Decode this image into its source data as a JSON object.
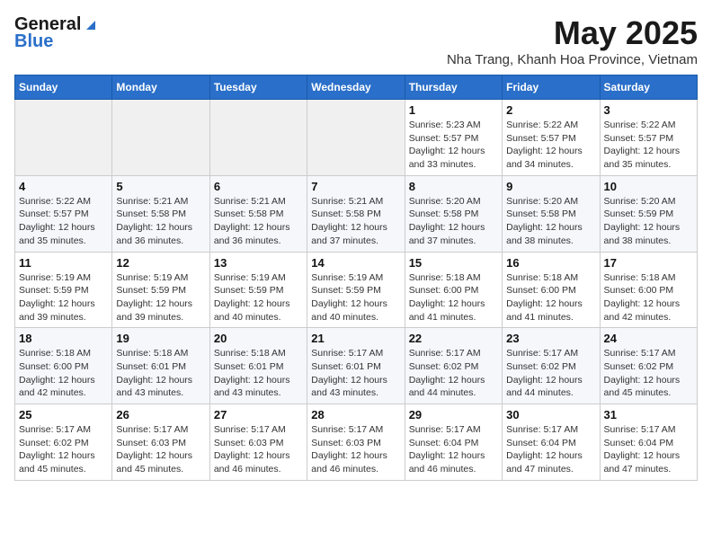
{
  "header": {
    "logo_line1": "General",
    "logo_line2": "Blue",
    "title": "May 2025",
    "subtitle": "Nha Trang, Khanh Hoa Province, Vietnam"
  },
  "calendar": {
    "days": [
      "Sunday",
      "Monday",
      "Tuesday",
      "Wednesday",
      "Thursday",
      "Friday",
      "Saturday"
    ],
    "weeks": [
      [
        {
          "date": "",
          "info": ""
        },
        {
          "date": "",
          "info": ""
        },
        {
          "date": "",
          "info": ""
        },
        {
          "date": "",
          "info": ""
        },
        {
          "date": "1",
          "info": "Sunrise: 5:23 AM\nSunset: 5:57 PM\nDaylight: 12 hours\nand 33 minutes."
        },
        {
          "date": "2",
          "info": "Sunrise: 5:22 AM\nSunset: 5:57 PM\nDaylight: 12 hours\nand 34 minutes."
        },
        {
          "date": "3",
          "info": "Sunrise: 5:22 AM\nSunset: 5:57 PM\nDaylight: 12 hours\nand 35 minutes."
        }
      ],
      [
        {
          "date": "4",
          "info": "Sunrise: 5:22 AM\nSunset: 5:57 PM\nDaylight: 12 hours\nand 35 minutes."
        },
        {
          "date": "5",
          "info": "Sunrise: 5:21 AM\nSunset: 5:58 PM\nDaylight: 12 hours\nand 36 minutes."
        },
        {
          "date": "6",
          "info": "Sunrise: 5:21 AM\nSunset: 5:58 PM\nDaylight: 12 hours\nand 36 minutes."
        },
        {
          "date": "7",
          "info": "Sunrise: 5:21 AM\nSunset: 5:58 PM\nDaylight: 12 hours\nand 37 minutes."
        },
        {
          "date": "8",
          "info": "Sunrise: 5:20 AM\nSunset: 5:58 PM\nDaylight: 12 hours\nand 37 minutes."
        },
        {
          "date": "9",
          "info": "Sunrise: 5:20 AM\nSunset: 5:58 PM\nDaylight: 12 hours\nand 38 minutes."
        },
        {
          "date": "10",
          "info": "Sunrise: 5:20 AM\nSunset: 5:59 PM\nDaylight: 12 hours\nand 38 minutes."
        }
      ],
      [
        {
          "date": "11",
          "info": "Sunrise: 5:19 AM\nSunset: 5:59 PM\nDaylight: 12 hours\nand 39 minutes."
        },
        {
          "date": "12",
          "info": "Sunrise: 5:19 AM\nSunset: 5:59 PM\nDaylight: 12 hours\nand 39 minutes."
        },
        {
          "date": "13",
          "info": "Sunrise: 5:19 AM\nSunset: 5:59 PM\nDaylight: 12 hours\nand 40 minutes."
        },
        {
          "date": "14",
          "info": "Sunrise: 5:19 AM\nSunset: 5:59 PM\nDaylight: 12 hours\nand 40 minutes."
        },
        {
          "date": "15",
          "info": "Sunrise: 5:18 AM\nSunset: 6:00 PM\nDaylight: 12 hours\nand 41 minutes."
        },
        {
          "date": "16",
          "info": "Sunrise: 5:18 AM\nSunset: 6:00 PM\nDaylight: 12 hours\nand 41 minutes."
        },
        {
          "date": "17",
          "info": "Sunrise: 5:18 AM\nSunset: 6:00 PM\nDaylight: 12 hours\nand 42 minutes."
        }
      ],
      [
        {
          "date": "18",
          "info": "Sunrise: 5:18 AM\nSunset: 6:00 PM\nDaylight: 12 hours\nand 42 minutes."
        },
        {
          "date": "19",
          "info": "Sunrise: 5:18 AM\nSunset: 6:01 PM\nDaylight: 12 hours\nand 43 minutes."
        },
        {
          "date": "20",
          "info": "Sunrise: 5:18 AM\nSunset: 6:01 PM\nDaylight: 12 hours\nand 43 minutes."
        },
        {
          "date": "21",
          "info": "Sunrise: 5:17 AM\nSunset: 6:01 PM\nDaylight: 12 hours\nand 43 minutes."
        },
        {
          "date": "22",
          "info": "Sunrise: 5:17 AM\nSunset: 6:02 PM\nDaylight: 12 hours\nand 44 minutes."
        },
        {
          "date": "23",
          "info": "Sunrise: 5:17 AM\nSunset: 6:02 PM\nDaylight: 12 hours\nand 44 minutes."
        },
        {
          "date": "24",
          "info": "Sunrise: 5:17 AM\nSunset: 6:02 PM\nDaylight: 12 hours\nand 45 minutes."
        }
      ],
      [
        {
          "date": "25",
          "info": "Sunrise: 5:17 AM\nSunset: 6:02 PM\nDaylight: 12 hours\nand 45 minutes."
        },
        {
          "date": "26",
          "info": "Sunrise: 5:17 AM\nSunset: 6:03 PM\nDaylight: 12 hours\nand 45 minutes."
        },
        {
          "date": "27",
          "info": "Sunrise: 5:17 AM\nSunset: 6:03 PM\nDaylight: 12 hours\nand 46 minutes."
        },
        {
          "date": "28",
          "info": "Sunrise: 5:17 AM\nSunset: 6:03 PM\nDaylight: 12 hours\nand 46 minutes."
        },
        {
          "date": "29",
          "info": "Sunrise: 5:17 AM\nSunset: 6:04 PM\nDaylight: 12 hours\nand 46 minutes."
        },
        {
          "date": "30",
          "info": "Sunrise: 5:17 AM\nSunset: 6:04 PM\nDaylight: 12 hours\nand 47 minutes."
        },
        {
          "date": "31",
          "info": "Sunrise: 5:17 AM\nSunset: 6:04 PM\nDaylight: 12 hours\nand 47 minutes."
        }
      ]
    ]
  }
}
